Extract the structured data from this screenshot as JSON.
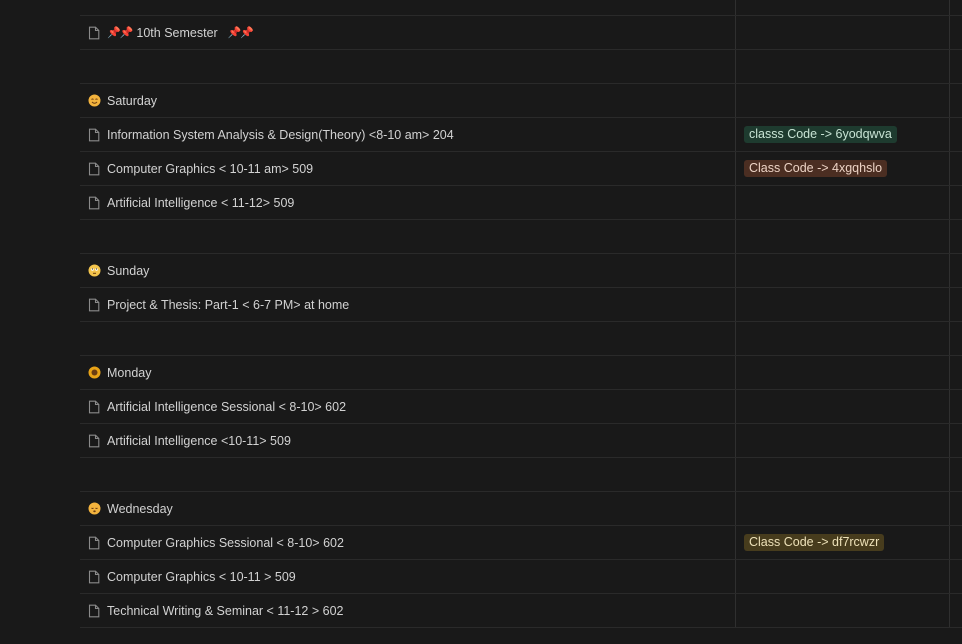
{
  "rows": [
    {
      "kind": "empty"
    },
    {
      "kind": "header",
      "pins": "📌📌",
      "title": "10th Semester",
      "pins_after": "📌📌"
    },
    {
      "kind": "empty"
    },
    {
      "kind": "day",
      "title": "Saturday",
      "emoji": "smiling-face-icon",
      "emoji_color": "#f3b33d"
    },
    {
      "kind": "item",
      "title": "Information System Analysis & Design(Theory) <8-10 am> 204",
      "tag": "classs Code -> 6yodqwva",
      "tag_bg": "#1e3b2f",
      "tag_fg": "#c8e3d4"
    },
    {
      "kind": "item",
      "title": "Computer Graphics < 10-11 am> 509",
      "tag": "Class Code -> 4xgqhslo",
      "tag_bg": "#4b2e22",
      "tag_fg": "#ecd3c5"
    },
    {
      "kind": "item",
      "title": "Artificial Intelligence < 11-12> 509"
    },
    {
      "kind": "empty"
    },
    {
      "kind": "day",
      "title": "Sunday",
      "emoji": "rolling-eyes-face-icon",
      "emoji_color": "#f3c44c"
    },
    {
      "kind": "item",
      "title": "Project & Thesis: Part-1 < 6-7 PM> at home"
    },
    {
      "kind": "empty"
    },
    {
      "kind": "day",
      "title": "Monday",
      "emoji": "sunflower-icon",
      "emoji_color": "#e8a317"
    },
    {
      "kind": "item",
      "title": "Artificial Intelligence Sessional < 8-10> 602"
    },
    {
      "kind": "item",
      "title": "Artificial Intelligence <10-11> 509"
    },
    {
      "kind": "empty"
    },
    {
      "kind": "day",
      "title": "Wednesday",
      "emoji": "sleepy-face-icon",
      "emoji_color": "#f3b33d"
    },
    {
      "kind": "item",
      "title": "Computer Graphics Sessional < 8-10> 602",
      "tag": "Class Code -> df7rcwzr",
      "tag_bg": "#473c1d",
      "tag_fg": "#ede1b8"
    },
    {
      "kind": "item",
      "title": "Computer Graphics < 10-11 > 509"
    },
    {
      "kind": "item",
      "title": "Technical Writing & Seminar < 11-12 > 602"
    }
  ]
}
